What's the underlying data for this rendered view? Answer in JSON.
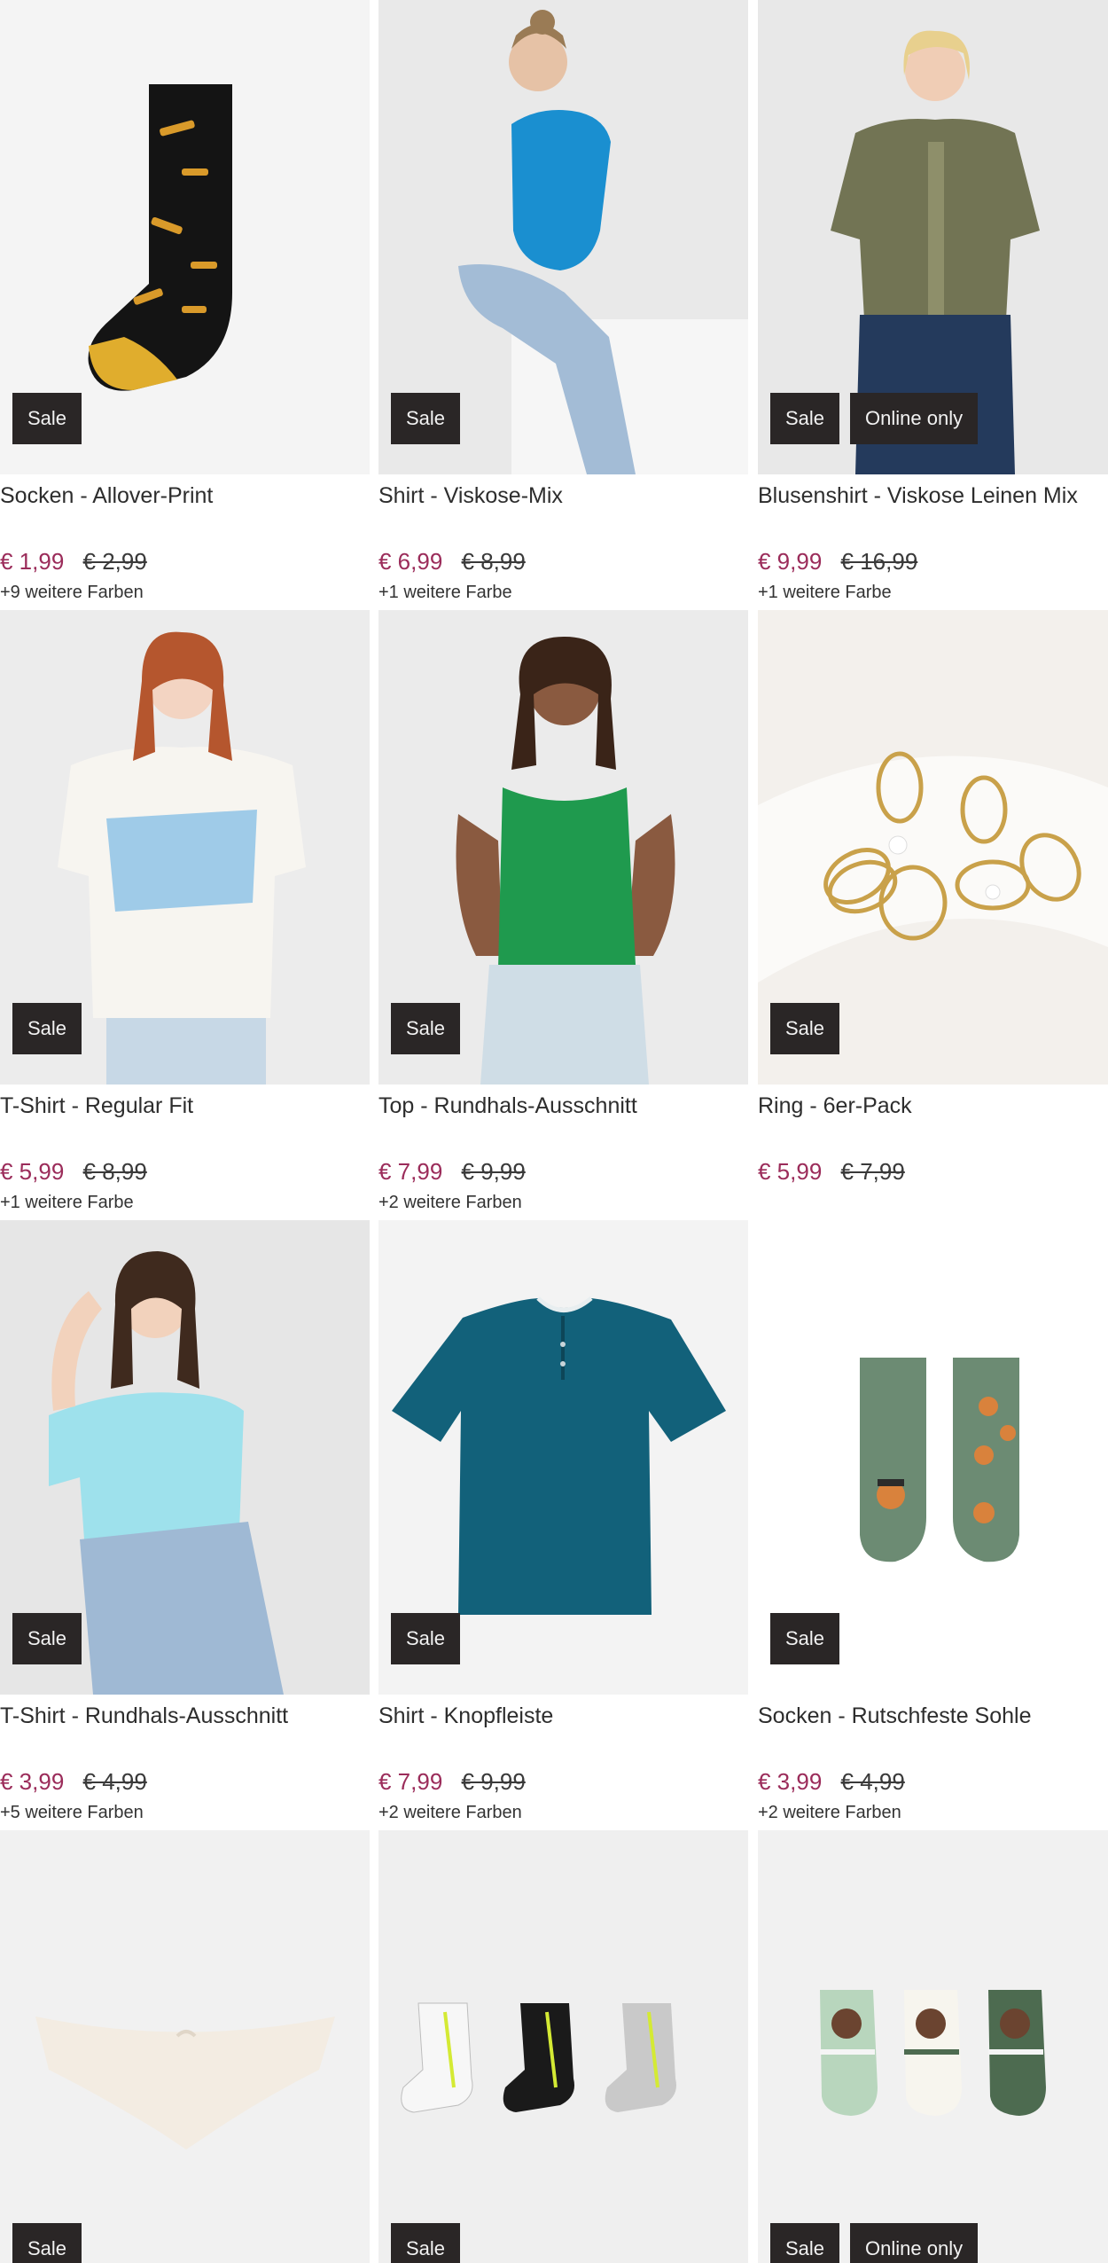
{
  "products": [
    {
      "title": "Socken - Allover-Print",
      "price": "€ 1,99",
      "old_price": "€ 2,99",
      "colors": "+9 weitere Farben",
      "badges": [
        "Sale"
      ],
      "image": "patterned-sock"
    },
    {
      "title": "Shirt - Viskose-Mix",
      "price": "€ 6,99",
      "old_price": "€ 8,99",
      "colors": "+1 weitere Farbe",
      "badges": [
        "Sale"
      ],
      "image": "model-blue-shirt"
    },
    {
      "title": "Blusenshirt - Viskose Leinen Mix",
      "price": "€ 9,99",
      "old_price": "€ 16,99",
      "colors": "+1 weitere Farbe",
      "badges": [
        "Sale",
        "Online only"
      ],
      "image": "model-olive-blouse"
    },
    {
      "title": "T-Shirt - Regular Fit",
      "price": "€ 5,99",
      "old_price": "€ 8,99",
      "colors": "+1 weitere Farbe",
      "badges": [
        "Sale"
      ],
      "image": "model-white-tshirt"
    },
    {
      "title": "Top - Rundhals-Ausschnitt",
      "price": "€ 7,99",
      "old_price": "€ 9,99",
      "colors": "+2 weitere Farben",
      "badges": [
        "Sale"
      ],
      "image": "model-green-top"
    },
    {
      "title": "Ring - 6er-Pack",
      "price": "€ 5,99",
      "old_price": "€ 7,99",
      "colors": "",
      "badges": [
        "Sale"
      ],
      "image": "gold-rings"
    },
    {
      "title": "T-Shirt - Rundhals-Ausschnitt",
      "price": "€ 3,99",
      "old_price": "€ 4,99",
      "colors": "+5 weitere Farben",
      "badges": [
        "Sale"
      ],
      "image": "model-lightblue-tshirt"
    },
    {
      "title": "Shirt - Knopfleiste",
      "price": "€ 7,99",
      "old_price": "€ 9,99",
      "colors": "+2 weitere Farben",
      "badges": [
        "Sale"
      ],
      "image": "teal-henley-shirt"
    },
    {
      "title": "Socken - Rutschfeste Sohle",
      "price": "€ 3,99",
      "old_price": "€ 4,99",
      "colors": "+2 weitere Farben",
      "badges": [
        "Sale"
      ],
      "image": "fox-socks"
    },
    {
      "title": "",
      "price": "",
      "old_price": "",
      "colors": "",
      "badges": [
        "Sale"
      ],
      "image": "cream-briefs"
    },
    {
      "title": "",
      "price": "",
      "old_price": "",
      "colors": "",
      "badges": [
        "Sale"
      ],
      "image": "sport-socks-3pack"
    },
    {
      "title": "",
      "price": "",
      "old_price": "",
      "colors": "",
      "badges": [
        "Sale",
        "Online only"
      ],
      "image": "bear-kids-socks"
    }
  ]
}
